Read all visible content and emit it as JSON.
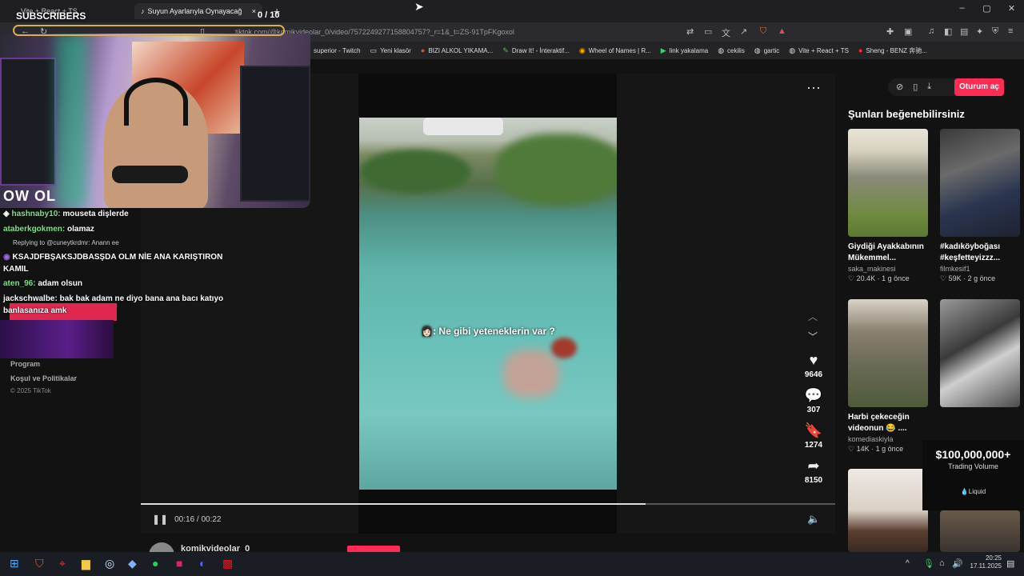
{
  "browser": {
    "tabs": [
      {
        "title": "Vite + React + TS"
      },
      {
        "title": "Suyun Ayarlarıyla Oynayacağ"
      }
    ],
    "new_tab_symbol": "+",
    "url": "tiktok.com/@komikvideolar_0/video/7572249277158804757?_r=1&_t=ZS-91TpFKgoxol",
    "bookmarks": [
      {
        "label": "superior - Twitch",
        "icon": "twitch-icon"
      },
      {
        "label": "Yeni klasör",
        "icon": "folder-icon"
      },
      {
        "label": "BIZI ALKOL YIKAMA...",
        "icon": "site-icon"
      },
      {
        "label": "Draw It! - İnteraktif...",
        "icon": "site-icon"
      },
      {
        "label": "Wheel of Names | R...",
        "icon": "site-icon"
      },
      {
        "label": "link yakalama",
        "icon": "site-icon"
      },
      {
        "label": "cekilis",
        "icon": "globe-icon"
      },
      {
        "label": "gartic",
        "icon": "globe-icon"
      },
      {
        "label": "Vite + React + TS",
        "icon": "globe-icon"
      },
      {
        "label": "Sheng - BENZ 奔驰...",
        "icon": "youtube-icon"
      }
    ]
  },
  "stream": {
    "subs_label": "SUBSCRIBERS",
    "goal": "0 / 10",
    "logo": "OW OL",
    "chat": [
      {
        "user": "hashnaby10:",
        "text": "mouseta dişlerde"
      },
      {
        "user": "ataberkgokmen:",
        "text": "olamaz"
      },
      {
        "user": "",
        "text": "KSAJDFBŞAKSJDBASŞDA OLM NİE ANA KARIŞTIRON"
      },
      {
        "user": "",
        "text": "KAMIL"
      },
      {
        "user": "aten_96:",
        "text": "adam olsun"
      },
      {
        "user": "jackschwalbe:",
        "text": "bak bak adam ne diyo bana ana bacı katıyo"
      },
      {
        "user": "",
        "text": "banlasanıza amk"
      }
    ],
    "reply_line": "Replying to @cuneytkrdmr: Anann ee"
  },
  "sidebar": {
    "links": [
      "Program",
      "Koşul ve Politikalar"
    ],
    "copyright": "© 2025 TikTok"
  },
  "video": {
    "caption": "👩🏻: Ne gibi yeteneklerin var ?",
    "time": "00:16 / 00:22",
    "progress": 0.727,
    "author": "komikvideolar_0",
    "likes": "9646",
    "comments": "307",
    "saves": "1274",
    "shares": "8150"
  },
  "header": {
    "login": "Oturum aç"
  },
  "suggestions": {
    "title": "Şunları beğenebilirsiniz",
    "cards": [
      {
        "title": "Giydiği Ayakkabının Mükemmel...",
        "user": "saka_makinesi",
        "likes": "20.4K",
        "age": "1 g önce"
      },
      {
        "title": "#kadıköyboğası #keşfetteyizzz...",
        "user": "filmkesif1",
        "likes": "59K",
        "age": "2 g önce"
      },
      {
        "title": "Harbi çekeceğin videonun 😂 ....",
        "user": "komediaskiyla",
        "likes": "14K",
        "age": "1 g önce"
      }
    ]
  },
  "ad": {
    "amount": "$100,000,000+",
    "subtitle": "Trading Volume",
    "brand": "Liquid"
  },
  "taskbar": {
    "time": "20:25",
    "date": "17.11.2025"
  },
  "colors": {
    "accent": "#fe2c55",
    "chat_user": "#7fe08a",
    "outline": "#d8b04a"
  }
}
